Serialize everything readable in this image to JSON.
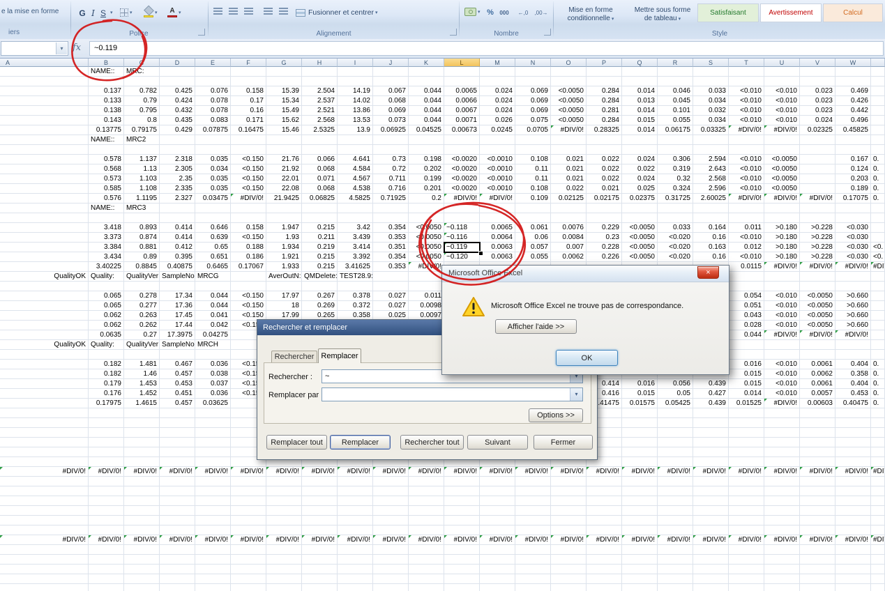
{
  "ribbon": {
    "left_fragment": {
      "line1": "e la mise en forme",
      "line2": "iers"
    },
    "police": {
      "label": "Police",
      "bold": "G",
      "italic": "I",
      "underline": "S"
    },
    "alignement": {
      "label": "Alignement",
      "merge": "Fusionner et centrer"
    },
    "nombre": {
      "label": "Nombre",
      "percent": "%",
      "thousands": "000",
      "dec_add": "←,0",
      "dec_del": ",00→"
    },
    "style": {
      "label": "Style",
      "conditional_l1": "Mise en forme",
      "conditional_l2": "conditionnelle",
      "table_l1": "Mettre sous forme",
      "table_l2": "de tableau",
      "gallery": [
        {
          "label": "Satisfaisant",
          "bg": "#e2f0d9",
          "fg": "#247a2d"
        },
        {
          "label": "Avertissement",
          "bg": "#ffffff",
          "fg": "#c00000"
        },
        {
          "label": "Calcul",
          "bg": "#faeadb",
          "fg": "#d2691e"
        }
      ]
    }
  },
  "formula_bar": {
    "name_box": "",
    "fx": "fx",
    "value": "~0.119"
  },
  "columns": [
    "A",
    "B",
    "C",
    "D",
    "E",
    "F",
    "G",
    "H",
    "I",
    "J",
    "K",
    "L",
    "M",
    "N",
    "O",
    "P",
    "Q",
    "R",
    "S",
    "T",
    "U",
    "V",
    "W",
    ""
  ],
  "selected": {
    "col": "L",
    "row": 19
  },
  "accents": {
    "selected_column_header": "#f3c35c",
    "annotation_ink": "#d21414",
    "flag_green": "#2f9e44"
  },
  "grid": {
    "div_value": "#DIV/0!",
    "rows": [
      {
        "r": 1,
        "cells": {
          "B": "NAME::",
          "C": "MRC:"
        }
      },
      {
        "r": 3,
        "cells": {
          "B": "0.137",
          "C": "0.782",
          "D": "0.425",
          "E": "0.076",
          "F": "0.158",
          "G": "15.39",
          "H": "2.504",
          "I": "14.19",
          "J": "0.067",
          "K": "0.044",
          "L": "0.0065",
          "M": "0.024",
          "N": "0.069",
          "O": "<0.0050",
          "P": "0.284",
          "Q": "0.014",
          "R": "0.046",
          "S": "0.033",
          "T": "<0.010",
          "U": "<0.010",
          "V": "0.023",
          "W": "0.469"
        }
      },
      {
        "r": 4,
        "cells": {
          "B": "0.133",
          "C": "0.79",
          "D": "0.424",
          "E": "0.078",
          "F": "0.17",
          "G": "15.34",
          "H": "2.537",
          "I": "14.02",
          "J": "0.068",
          "K": "0.044",
          "L": "0.0066",
          "M": "0.024",
          "N": "0.069",
          "O": "<0.0050",
          "P": "0.284",
          "Q": "0.013",
          "R": "0.045",
          "S": "0.034",
          "T": "<0.010",
          "U": "<0.010",
          "V": "0.023",
          "W": "0.426"
        }
      },
      {
        "r": 5,
        "cells": {
          "B": "0.138",
          "C": "0.795",
          "D": "0.432",
          "E": "0.078",
          "F": "0.16",
          "G": "15.49",
          "H": "2.521",
          "I": "13.86",
          "J": "0.069",
          "K": "0.044",
          "L": "0.0067",
          "M": "0.024",
          "N": "0.069",
          "O": "<0.0050",
          "P": "0.281",
          "Q": "0.014",
          "R": "0.101",
          "S": "0.032",
          "T": "<0.010",
          "U": "<0.010",
          "V": "0.023",
          "W": "0.442"
        }
      },
      {
        "r": 6,
        "cells": {
          "B": "0.143",
          "C": "0.8",
          "D": "0.435",
          "E": "0.083",
          "F": "0.171",
          "G": "15.62",
          "H": "2.568",
          "I": "13.53",
          "J": "0.073",
          "K": "0.044",
          "L": "0.0071",
          "M": "0.026",
          "N": "0.075",
          "O": "<0.0050",
          "P": "0.284",
          "Q": "0.015",
          "R": "0.055",
          "S": "0.034",
          "T": "<0.010",
          "U": "<0.010",
          "V": "0.024",
          "W": "0.496"
        }
      },
      {
        "r": 7,
        "cells": {
          "B": "0.13775",
          "C": "0.79175",
          "D": "0.429",
          "E": "0.07875",
          "F": "0.16475",
          "G": "15.46",
          "H": "2.5325",
          "I": "13.9",
          "J": "0.06925",
          "K": "0.04525",
          "L": "0.00673",
          "M": "0.0245",
          "N": "0.0705",
          "O": "#DIV/0!",
          "P": "0.28325",
          "Q": "0.014",
          "R": "0.06175",
          "S": "0.03325",
          "T": "#DIV/0!",
          "U": "#DIV/0!",
          "V": "0.02325",
          "W": "0.45825"
        }
      },
      {
        "r": 8,
        "cells": {
          "B": "NAME::",
          "C": "MRC2"
        }
      },
      {
        "r": 10,
        "cells": {
          "B": "0.578",
          "C": "1.137",
          "D": "2.318",
          "E": "0.035",
          "F": "<0.150",
          "G": "21.76",
          "H": "0.066",
          "I": "4.641",
          "J": "0.73",
          "K": "0.198",
          "L": "<0.0020",
          "M": "<0.0010",
          "N": "0.108",
          "O": "0.021",
          "P": "0.022",
          "Q": "0.024",
          "R": "0.306",
          "S": "2.594",
          "T": "<0.010",
          "U": "<0.0050",
          "W": "0.167",
          "X": "0."
        }
      },
      {
        "r": 11,
        "cells": {
          "B": "0.568",
          "C": "1.13",
          "D": "2.305",
          "E": "0.034",
          "F": "<0.150",
          "G": "21.92",
          "H": "0.068",
          "I": "4.584",
          "J": "0.72",
          "K": "0.202",
          "L": "<0.0020",
          "M": "<0.0010",
          "N": "0.11",
          "O": "0.021",
          "P": "0.022",
          "Q": "0.022",
          "R": "0.319",
          "S": "2.643",
          "T": "<0.010",
          "U": "<0.0050",
          "W": "0.124",
          "X": "0."
        }
      },
      {
        "r": 12,
        "cells": {
          "B": "0.573",
          "C": "1.103",
          "D": "2.35",
          "E": "0.035",
          "F": "<0.150",
          "G": "22.01",
          "H": "0.071",
          "I": "4.567",
          "J": "0.711",
          "K": "0.199",
          "L": "<0.0020",
          "M": "<0.0010",
          "N": "0.11",
          "O": "0.021",
          "P": "0.022",
          "Q": "0.024",
          "R": "0.32",
          "S": "2.568",
          "T": "<0.010",
          "U": "<0.0050",
          "W": "0.203",
          "X": "0."
        }
      },
      {
        "r": 13,
        "cells": {
          "B": "0.585",
          "C": "1.108",
          "D": "2.335",
          "E": "0.035",
          "F": "<0.150",
          "G": "22.08",
          "H": "0.068",
          "I": "4.538",
          "J": "0.716",
          "K": "0.201",
          "L": "<0.0020",
          "M": "<0.0010",
          "N": "0.108",
          "O": "0.022",
          "P": "0.021",
          "Q": "0.025",
          "R": "0.324",
          "S": "2.596",
          "T": "<0.010",
          "U": "<0.0050",
          "W": "0.189",
          "X": "0."
        }
      },
      {
        "r": 14,
        "cells": {
          "B": "0.576",
          "C": "1.1195",
          "D": "2.327",
          "E": "0.03475",
          "F": "#DIV/0!",
          "G": "21.9425",
          "H": "0.06825",
          "I": "4.5825",
          "J": "0.71925",
          "K": "0.2",
          "L": "#DIV/0!",
          "M": "#DIV/0!",
          "N": "0.109",
          "O": "0.02125",
          "P": "0.02175",
          "Q": "0.02375",
          "R": "0.31725",
          "S": "2.60025",
          "T": "#DIV/0!",
          "U": "#DIV/0!",
          "V": "#DIV/0!",
          "W": "0.17075",
          "X": "0."
        }
      },
      {
        "r": 15,
        "cells": {
          "B": "NAME::",
          "C": "MRC3"
        }
      },
      {
        "r": 17,
        "cells": {
          "B": "3.418",
          "C": "0.893",
          "D": "0.414",
          "E": "0.646",
          "F": "0.158",
          "G": "1.947",
          "H": "0.215",
          "I": "3.42",
          "J": "0.354",
          "K": "<0.0050",
          "L": "~0.118",
          "M": "0.0065",
          "N": "0.061",
          "O": "0.0076",
          "P": "0.229",
          "Q": "<0.0050",
          "R": "0.033",
          "S": "0.164",
          "T": "0.011",
          "U": ">0.180",
          "V": ">0.228",
          "W": "<0.030"
        }
      },
      {
        "r": 18,
        "cells": {
          "B": "3.373",
          "C": "0.874",
          "D": "0.414",
          "E": "0.639",
          "F": "<0.150",
          "G": "1.93",
          "H": "0.211",
          "I": "3.439",
          "J": "0.353",
          "K": "<0.0050",
          "L": "~0.116",
          "M": "0.0064",
          "N": "0.06",
          "O": "0.0084",
          "P": "0.23",
          "Q": "<0.0050",
          "R": "<0.020",
          "S": "0.16",
          "T": "<0.010",
          "U": ">0.180",
          "V": ">0.228",
          "W": "<0.030"
        }
      },
      {
        "r": 19,
        "cells": {
          "B": "3.384",
          "C": "0.881",
          "D": "0.412",
          "E": "0.65",
          "F": "0.188",
          "G": "1.934",
          "H": "0.219",
          "I": "3.414",
          "J": "0.351",
          "K": "<0.0050",
          "L": "~0.119",
          "M": "0.0063",
          "N": "0.057",
          "O": "0.007",
          "P": "0.228",
          "Q": "<0.0050",
          "R": "<0.020",
          "S": "0.163",
          "T": "0.012",
          "U": ">0.180",
          "V": ">0.228",
          "W": "<0.030",
          "X": "<0."
        }
      },
      {
        "r": 20,
        "cells": {
          "B": "3.434",
          "C": "0.89",
          "D": "0.395",
          "E": "0.651",
          "F": "0.186",
          "G": "1.921",
          "H": "0.215",
          "I": "3.392",
          "J": "0.354",
          "K": "<0.0050",
          "L": "~0.120",
          "M": "0.0063",
          "N": "0.055",
          "O": "0.0062",
          "P": "0.226",
          "Q": "<0.0050",
          "R": "<0.020",
          "S": "0.16",
          "T": "<0.010",
          "U": ">0.180",
          "V": ">0.228",
          "W": "<0.030",
          "X": "<0."
        }
      },
      {
        "r": 21,
        "cells": {
          "B": "3.40225",
          "C": "0.8845",
          "D": "0.40875",
          "E": "0.6465",
          "F": "0.17067",
          "G": "1.933",
          "H": "0.215",
          "I": "3.41625",
          "J": "0.353",
          "K": "#DIV/0!",
          "T": "0.0115",
          "U": "#DIV/0!",
          "V": "#DIV/0!",
          "W": "#DIV/0!",
          "X": "#DIV/0!"
        }
      },
      {
        "r": 22,
        "cells": {
          "A": "QualityOK",
          "B": "Quality:",
          "C": "QualityVer",
          "D": "SampleNo",
          "E": "MRCG",
          "G": "AverOutN:",
          "H": "QMDelete:",
          "I": "TEST28.9:"
        }
      },
      {
        "r": 24,
        "cells": {
          "B": "0.065",
          "C": "0.278",
          "D": "17.34",
          "E": "0.044",
          "F": "<0.150",
          "G": "17.97",
          "H": "0.267",
          "I": "0.378",
          "J": "0.027",
          "K": "0.011",
          "T": "0.054",
          "U": "<0.010",
          "V": "<0.0050",
          "W": ">0.660"
        }
      },
      {
        "r": 25,
        "cells": {
          "B": "0.065",
          "C": "0.277",
          "D": "17.36",
          "E": "0.044",
          "F": "<0.150",
          "G": "18",
          "H": "0.269",
          "I": "0.372",
          "J": "0.027",
          "K": "0.0098",
          "T": "0.051",
          "U": "<0.010",
          "V": "<0.0050",
          "W": ">0.660"
        }
      },
      {
        "r": 26,
        "cells": {
          "B": "0.062",
          "C": "0.263",
          "D": "17.45",
          "E": "0.041",
          "F": "<0.150",
          "G": "17.99",
          "H": "0.265",
          "I": "0.358",
          "J": "0.025",
          "K": "0.0097",
          "T": "0.043",
          "U": "<0.010",
          "V": "<0.0050",
          "W": ">0.660"
        }
      },
      {
        "r": 27,
        "cells": {
          "B": "0.062",
          "C": "0.262",
          "D": "17.44",
          "E": "0.042",
          "F": "<0.150",
          "T": "0.028",
          "U": "<0.010",
          "V": "<0.0050",
          "W": ">0.660"
        }
      },
      {
        "r": 28,
        "cells": {
          "B": "0.0635",
          "C": "0.27",
          "D": "17.3975",
          "E": "0.04275",
          "T": "0.044",
          "U": "#DIV/0!",
          "V": "#DIV/0!",
          "W": "#DIV/0!"
        }
      },
      {
        "r": 29,
        "cells": {
          "A": "QualityOK",
          "B": "Quality:",
          "C": "QualityVer",
          "D": "SampleNo",
          "E": "MRCH"
        }
      },
      {
        "r": 31,
        "cells": {
          "B": "0.182",
          "C": "1.481",
          "D": "0.467",
          "E": "0.036",
          "F": "<0.150",
          "T": "0.016",
          "U": "<0.010",
          "V": "0.0061",
          "W": "0.404",
          "X": "0."
        }
      },
      {
        "r": 32,
        "cells": {
          "B": "0.182",
          "C": "1.46",
          "D": "0.457",
          "E": "0.038",
          "F": "<0.150",
          "T": "0.015",
          "U": "<0.010",
          "V": "0.0062",
          "W": "0.358",
          "X": "0."
        }
      },
      {
        "r": 33,
        "cells": {
          "B": "0.179",
          "C": "1.453",
          "D": "0.453",
          "E": "0.037",
          "F": "<0.150",
          "P": "0.414",
          "Q": "0.016",
          "R": "0.056",
          "S": "0.439",
          "T": "0.015",
          "U": "<0.010",
          "V": "0.0061",
          "W": "0.404",
          "X": "0."
        }
      },
      {
        "r": 34,
        "cells": {
          "B": "0.176",
          "C": "1.452",
          "D": "0.451",
          "E": "0.036",
          "F": "<0.150",
          "P": "0.416",
          "Q": "0.015",
          "R": "0.05",
          "S": "0.427",
          "T": "0.014",
          "U": "<0.010",
          "V": "0.0057",
          "W": "0.453",
          "X": "0."
        }
      },
      {
        "r": 35,
        "cells": {
          "B": "0.17975",
          "C": "1.4615",
          "D": "0.457",
          "E": "0.03625",
          "P": "0.41475",
          "Q": "0.01575",
          "R": "0.05425",
          "S": "0.439",
          "T": "0.01525",
          "U": "#DIV/0!",
          "V": "0.00603",
          "W": "0.40475",
          "X": "0."
        }
      },
      {
        "r": 42,
        "div": true
      },
      {
        "r": 49,
        "div": true
      }
    ]
  },
  "find_dialog": {
    "title": "Rechercher et remplacer",
    "tabs": [
      {
        "label": "Rechercher",
        "active": false
      },
      {
        "label": "Remplacer",
        "active": true
      }
    ],
    "find_label": "Rechercher :",
    "find_value": "~",
    "replace_label": "Remplacer par :",
    "replace_value": "",
    "options_button": "Options >>",
    "buttons": [
      "Remplacer tout",
      "Remplacer",
      "Rechercher tout",
      "Suivant",
      "Fermer"
    ]
  },
  "message_dialog": {
    "title": "Microsoft Office Excel",
    "message": "Microsoft Office Excel ne trouve pas de correspondance.",
    "help_button": "Afficher l'aide >>",
    "ok_button": "OK",
    "close_icon": "×"
  }
}
